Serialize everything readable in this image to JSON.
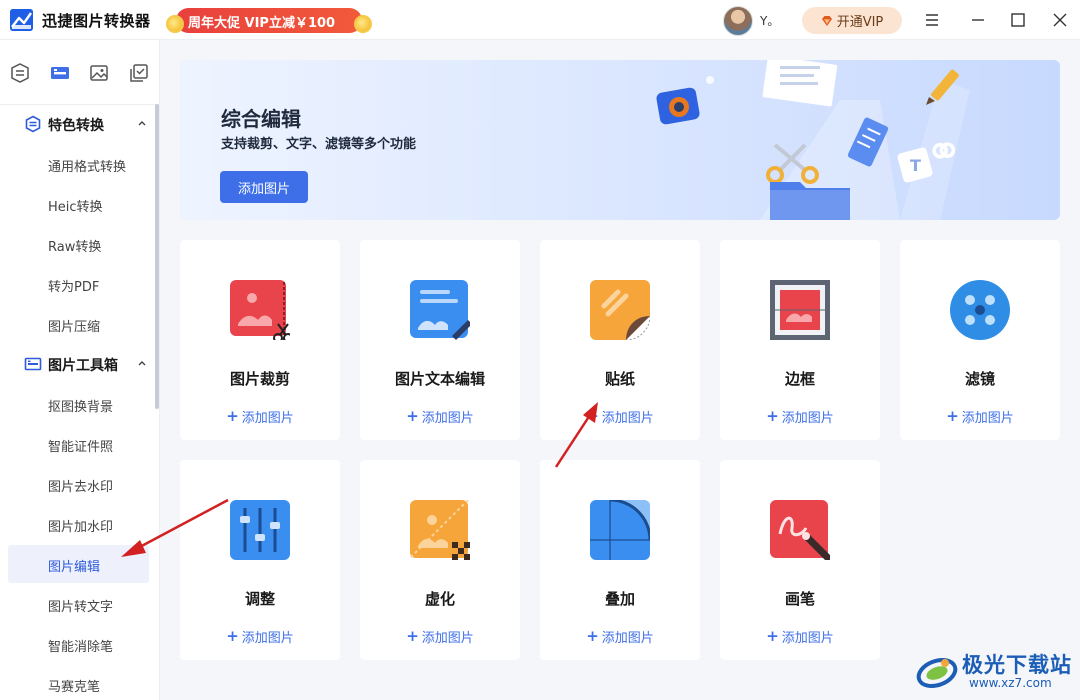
{
  "app": {
    "title": "迅捷图片转换器",
    "promo": "周年大促 VIP立减￥100",
    "username": "Y。",
    "vip_button": "开通VIP",
    "window_controls": [
      "menu-icon",
      "minimize-icon",
      "maximize-icon",
      "close-icon"
    ]
  },
  "sidebar": {
    "tool_tabs": [
      "convert-icon",
      "toolbox-icon",
      "image-icon",
      "batch-icon"
    ],
    "groups": [
      {
        "label": "特色转换",
        "icon": "convert-icon",
        "expanded": true,
        "items": [
          "通用格式转换",
          "Heic转换",
          "Raw转换",
          "转为PDF",
          "图片压缩"
        ]
      },
      {
        "label": "图片工具箱",
        "icon": "toolbox-icon",
        "expanded": true,
        "items": [
          "抠图换背景",
          "智能证件照",
          "图片去水印",
          "图片加水印",
          "图片编辑",
          "图片转文字",
          "智能消除笔",
          "马赛克笔"
        ]
      }
    ],
    "active_item": "图片编辑"
  },
  "banner": {
    "title": "综合编辑",
    "subtitle": "支持裁剪、文字、滤镜等多个功能",
    "button": "添加图片"
  },
  "tools": [
    {
      "title": "图片裁剪",
      "icon": "crop-icon",
      "action": "添加图片"
    },
    {
      "title": "图片文本编辑",
      "icon": "text-edit-icon",
      "action": "添加图片"
    },
    {
      "title": "贴纸",
      "icon": "sticker-icon",
      "action": "添加图片"
    },
    {
      "title": "边框",
      "icon": "frame-icon",
      "action": "添加图片"
    },
    {
      "title": "滤镜",
      "icon": "filter-icon",
      "action": "添加图片"
    },
    {
      "title": "调整",
      "icon": "adjust-icon",
      "action": "添加图片"
    },
    {
      "title": "虚化",
      "icon": "blur-icon",
      "action": "添加图片"
    },
    {
      "title": "叠加",
      "icon": "overlay-icon",
      "action": "添加图片"
    },
    {
      "title": "画笔",
      "icon": "brush-icon",
      "action": "添加图片"
    }
  ],
  "watermark": {
    "title": "极光下载站",
    "url": "www.xz7.com"
  },
  "colors": {
    "accent": "#3e6fe8",
    "annotation_arrow": "#d32020",
    "promo": "#e8403c"
  }
}
